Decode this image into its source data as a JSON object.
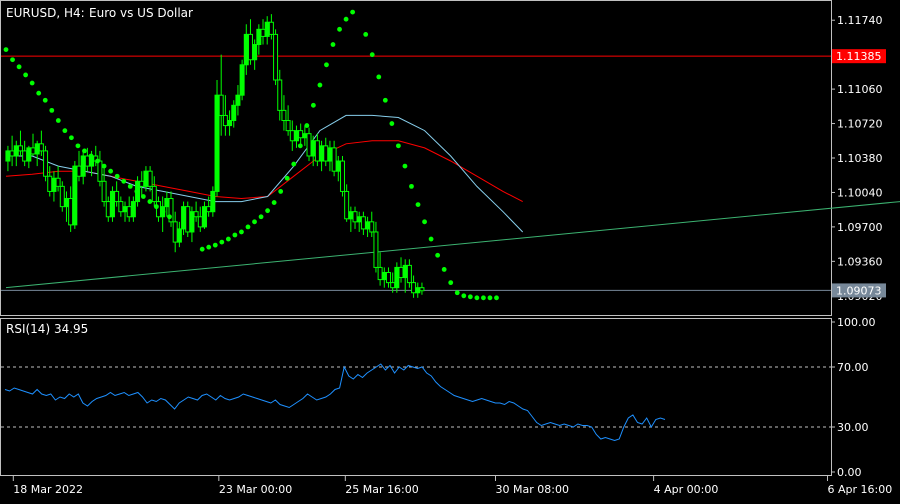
{
  "header": {
    "symbol_label": "EURUSD, H4:",
    "description": "Euro vs US Dollar"
  },
  "rsi_panel": {
    "label": "RSI(14) 34.95"
  },
  "colors": {
    "background": "#000000",
    "frame": "#c0c0c0",
    "bull_candle": "#00ff00",
    "bear_candle": "#000000",
    "sar": "#00ff00",
    "ma_fast": "#87ceeb",
    "ma_slow": "#ff0000",
    "trendline": "#3cb371",
    "resistance_line": "#ff0000",
    "bid_line": "#778899",
    "rsi_line": "#1e90ff",
    "rsi_levels": "#c0c0c0",
    "text": "#ffffff",
    "resistance_badge": "#ff0000",
    "bid_badge": "#778899"
  },
  "chart_data": [
    {
      "type": "candlestick",
      "symbol": "EURUSD",
      "timeframe": "H4",
      "y_ticks": [
        "1.11740",
        "1.11400",
        "1.11060",
        "1.10720",
        "1.10380",
        "1.10040",
        "1.09700",
        "1.09360",
        "1.09020"
      ],
      "ylim": [
        1.0886,
        1.119
      ],
      "x_tick_labels": [
        {
          "label": "18 Mar 2022",
          "bar": 0
        },
        {
          "label": "23 Mar 00:00",
          "bar": 26
        },
        {
          "label": "25 Mar 16:00",
          "bar": 42
        },
        {
          "label": "30 Mar 08:00",
          "bar": 61
        },
        {
          "label": "4 Apr 00:00",
          "bar": 81
        },
        {
          "label": "6 Apr 16:00",
          "bar": 103
        }
      ],
      "price_badges": [
        {
          "label": "1.11385",
          "price": 1.11385,
          "role": "resistance"
        },
        {
          "label": "1.09073",
          "price": 1.09073,
          "role": "bid"
        }
      ],
      "candles": [
        [
          1.1035,
          1.105,
          1.1025,
          1.1045
        ],
        [
          1.1045,
          1.106,
          1.103,
          1.104
        ],
        [
          1.104,
          1.1055,
          1.103,
          1.105
        ],
        [
          1.105,
          1.1065,
          1.104,
          1.1045
        ],
        [
          1.1045,
          1.1055,
          1.103,
          1.1035
        ],
        [
          1.1035,
          1.105,
          1.1028,
          1.1048
        ],
        [
          1.1048,
          1.1062,
          1.104,
          1.1042
        ],
        [
          1.1042,
          1.1055,
          1.103,
          1.1052
        ],
        [
          1.1052,
          1.1065,
          1.104,
          1.1045
        ],
        [
          1.1045,
          1.105,
          1.1015,
          1.102
        ],
        [
          1.102,
          1.103,
          1.1,
          1.1005
        ],
        [
          1.1005,
          1.1025,
          1.0995,
          1.1018
        ],
        [
          1.1018,
          1.103,
          1.1005,
          1.101
        ],
        [
          1.101,
          1.1015,
          1.0985,
          1.099
        ],
        [
          1.099,
          1.1005,
          1.0975,
          1.0998
        ],
        [
          1.0998,
          1.101,
          1.0965,
          1.0972
        ],
        [
          1.0972,
          1.1035,
          1.0968,
          1.103
        ],
        [
          1.103,
          1.1045,
          1.1015,
          1.102
        ],
        [
          1.102,
          1.1045,
          1.1012,
          1.104
        ],
        [
          1.104,
          1.1048,
          1.1025,
          1.103
        ],
        [
          1.103,
          1.1045,
          1.102,
          1.104
        ],
        [
          1.104,
          1.105,
          1.103,
          1.1035
        ],
        [
          1.1035,
          1.1045,
          1.101,
          1.1015
        ],
        [
          1.1015,
          1.103,
          1.099,
          1.0995
        ],
        [
          1.0995,
          1.1,
          1.0975,
          1.098
        ],
        [
          1.098,
          1.101,
          1.0975,
          1.1005
        ],
        [
          1.1005,
          1.1015,
          1.099,
          1.0995
        ],
        [
          1.0995,
          1.1,
          1.098,
          1.0985
        ],
        [
          1.0985,
          1.0995,
          1.0975,
          1.099
        ],
        [
          1.099,
          1.1,
          1.0975,
          1.098
        ],
        [
          1.098,
          1.1,
          1.0975,
          1.0995
        ],
        [
          1.0995,
          1.102,
          1.099,
          1.1015
        ],
        [
          1.1015,
          1.1025,
          1.1,
          1.101
        ],
        [
          1.101,
          1.103,
          1.1005,
          1.1025
        ],
        [
          1.1025,
          1.103,
          1.1005,
          1.101
        ],
        [
          1.101,
          1.102,
          1.099,
          1.0995
        ],
        [
          1.0995,
          1.1,
          1.0975,
          1.098
        ],
        [
          1.098,
          1.1,
          1.0965,
          1.099
        ],
        [
          1.099,
          1.1005,
          1.098,
          1.0998
        ],
        [
          1.0998,
          1.1005,
          1.097,
          1.0975
        ],
        [
          1.0975,
          1.0985,
          1.0945,
          1.0955
        ],
        [
          1.0955,
          1.0975,
          1.095,
          1.0968
        ],
        [
          1.0968,
          1.0995,
          1.0962,
          1.099
        ],
        [
          1.099,
          1.0995,
          1.096,
          1.0965
        ],
        [
          1.0965,
          1.099,
          1.0955,
          1.0985
        ],
        [
          1.0985,
          1.0995,
          1.0975,
          1.098
        ],
        [
          1.098,
          1.099,
          1.0965,
          1.097
        ],
        [
          1.097,
          1.0995,
          1.0968,
          1.099
        ],
        [
          1.099,
          1.1,
          1.098,
          1.0985
        ],
        [
          1.0985,
          1.101,
          1.098,
          1.1005
        ],
        [
          1.1005,
          1.1115,
          1.1,
          1.11
        ],
        [
          1.11,
          1.114,
          1.106,
          1.108
        ],
        [
          1.108,
          1.11,
          1.106,
          1.107
        ],
        [
          1.107,
          1.1085,
          1.106,
          1.1075
        ],
        [
          1.1075,
          1.1095,
          1.1068,
          1.109
        ],
        [
          1.109,
          1.111,
          1.108,
          1.11
        ],
        [
          1.11,
          1.1135,
          1.1095,
          1.113
        ],
        [
          1.113,
          1.117,
          1.112,
          1.116
        ],
        [
          1.116,
          1.1175,
          1.113,
          1.1135
        ],
        [
          1.1135,
          1.1155,
          1.1125,
          1.115
        ],
        [
          1.115,
          1.117,
          1.114,
          1.1165
        ],
        [
          1.1165,
          1.1175,
          1.115,
          1.1158
        ],
        [
          1.1158,
          1.1178,
          1.115,
          1.1172
        ],
        [
          1.1172,
          1.118,
          1.1155,
          1.116
        ],
        [
          1.116,
          1.1165,
          1.111,
          1.1115
        ],
        [
          1.1115,
          1.1125,
          1.1075,
          1.1085
        ],
        [
          1.1085,
          1.11,
          1.1065,
          1.1075
        ],
        [
          1.1075,
          1.109,
          1.106,
          1.1065
        ],
        [
          1.1065,
          1.1075,
          1.1045,
          1.1055
        ],
        [
          1.1055,
          1.107,
          1.1048,
          1.1065
        ],
        [
          1.1065,
          1.1072,
          1.105,
          1.1058
        ],
        [
          1.1058,
          1.107,
          1.105,
          1.1062
        ],
        [
          1.1062,
          1.1068,
          1.1035,
          1.104
        ],
        [
          1.104,
          1.106,
          1.103,
          1.1055
        ],
        [
          1.1055,
          1.1062,
          1.103,
          1.1035
        ],
        [
          1.1035,
          1.1055,
          1.1025,
          1.105
        ],
        [
          1.105,
          1.1058,
          1.103,
          1.1035
        ],
        [
          1.1035,
          1.1055,
          1.1025,
          1.1048
        ],
        [
          1.1048,
          1.1055,
          1.102,
          1.1025
        ],
        [
          1.1025,
          1.104,
          1.1015,
          1.1035
        ],
        [
          1.1035,
          1.104,
          1.1,
          1.1005
        ],
        [
          1.1005,
          1.1012,
          1.0975,
          1.0978
        ],
        [
          1.0978,
          1.099,
          1.0965,
          1.0985
        ],
        [
          1.0985,
          1.099,
          1.0968,
          1.0975
        ],
        [
          1.0975,
          1.0985,
          1.0965,
          1.098
        ],
        [
          1.098,
          1.0985,
          1.0962,
          1.0968
        ],
        [
          1.0968,
          1.098,
          1.096,
          1.0975
        ],
        [
          1.0975,
          1.0985,
          1.096,
          1.0965
        ],
        [
          1.0965,
          1.0975,
          1.0925,
          1.093
        ],
        [
          1.093,
          1.0945,
          1.0912,
          1.0918
        ],
        [
          1.0918,
          1.093,
          1.091,
          1.0925
        ],
        [
          1.0925,
          1.093,
          1.091,
          1.0915
        ],
        [
          1.0915,
          1.0925,
          1.0905,
          1.091
        ],
        [
          1.091,
          1.0935,
          1.0905,
          1.093
        ],
        [
          1.093,
          1.094,
          1.0915,
          1.092
        ],
        [
          1.092,
          1.0938,
          1.0905,
          1.0932
        ],
        [
          1.0932,
          1.0938,
          1.091,
          1.0915
        ],
        [
          1.0915,
          1.0922,
          1.09,
          1.0905
        ],
        [
          1.0905,
          1.0915,
          1.09,
          1.091
        ],
        [
          1.091,
          1.0915,
          1.0903,
          1.0907
        ]
      ],
      "parabolic_sar": [
        [
          0,
          1.1145
        ],
        [
          2,
          1.1135
        ],
        [
          4,
          1.1128
        ],
        [
          6,
          1.112
        ],
        [
          8,
          1.1112
        ],
        [
          10,
          1.1102
        ],
        [
          12,
          1.1095
        ],
        [
          14,
          1.1085
        ],
        [
          16,
          1.1075
        ],
        [
          18,
          1.1065
        ],
        [
          20,
          1.1058
        ],
        [
          22,
          1.105
        ],
        [
          24,
          1.1045
        ],
        [
          26,
          1.104
        ],
        [
          28,
          1.1035
        ],
        [
          30,
          1.103
        ],
        [
          32,
          1.1025
        ],
        [
          34,
          1.102
        ],
        [
          36,
          1.1015
        ],
        [
          38,
          1.101
        ],
        [
          40,
          1.1005
        ],
        [
          42,
          1.1
        ],
        [
          44,
          1.0995
        ],
        [
          46,
          1.099
        ],
        [
          48,
          1.0985
        ],
        [
          50,
          1.098
        ],
        [
          60,
          1.0948
        ],
        [
          62,
          1.095
        ],
        [
          64,
          1.0952
        ],
        [
          66,
          1.0955
        ],
        [
          68,
          1.0958
        ],
        [
          70,
          1.0962
        ],
        [
          72,
          1.0965
        ],
        [
          74,
          1.097
        ],
        [
          76,
          1.0975
        ],
        [
          78,
          1.098
        ],
        [
          80,
          1.0986
        ],
        [
          82,
          1.0994
        ],
        [
          84,
          1.1005
        ],
        [
          86,
          1.1018
        ],
        [
          88,
          1.1032
        ],
        [
          90,
          1.105
        ],
        [
          92,
          1.107
        ],
        [
          94,
          1.109
        ],
        [
          96,
          1.111
        ],
        [
          98,
          1.113
        ],
        [
          100,
          1.115
        ],
        [
          102,
          1.1165
        ],
        [
          104,
          1.1175
        ],
        [
          106,
          1.1182
        ],
        [
          110,
          1.116
        ],
        [
          112,
          1.114
        ],
        [
          114,
          1.1118
        ],
        [
          116,
          1.1095
        ],
        [
          118,
          1.1072
        ],
        [
          120,
          1.105
        ],
        [
          122,
          1.103
        ],
        [
          124,
          1.101
        ],
        [
          126,
          1.0992
        ],
        [
          128,
          1.0975
        ],
        [
          130,
          1.0958
        ],
        [
          132,
          1.0942
        ],
        [
          134,
          1.0928
        ],
        [
          136,
          1.0915
        ],
        [
          138,
          1.0905
        ],
        [
          140,
          1.0902
        ],
        [
          142,
          1.0901
        ],
        [
          144,
          1.09
        ],
        [
          146,
          1.09
        ],
        [
          148,
          1.09
        ],
        [
          150,
          1.09
        ]
      ],
      "ma_fast": [
        [
          0,
          1.104
        ],
        [
          8,
          1.104
        ],
        [
          16,
          1.103
        ],
        [
          24,
          1.1025
        ],
        [
          32,
          1.102
        ],
        [
          40,
          1.101
        ],
        [
          48,
          1.1005
        ],
        [
          56,
          1.1
        ],
        [
          64,
          1.0995
        ],
        [
          72,
          1.0995
        ],
        [
          80,
          1.1
        ],
        [
          88,
          1.103
        ],
        [
          96,
          1.1065
        ],
        [
          104,
          1.108
        ],
        [
          112,
          1.108
        ],
        [
          120,
          1.1078
        ],
        [
          128,
          1.1065
        ],
        [
          136,
          1.104
        ],
        [
          144,
          1.101
        ],
        [
          152,
          1.0985
        ],
        [
          158,
          1.0965
        ]
      ],
      "ma_slow": [
        [
          0,
          1.102
        ],
        [
          8,
          1.1022
        ],
        [
          16,
          1.1025
        ],
        [
          24,
          1.1025
        ],
        [
          32,
          1.102
        ],
        [
          40,
          1.1015
        ],
        [
          48,
          1.101
        ],
        [
          56,
          1.1005
        ],
        [
          64,
          1.1
        ],
        [
          72,
          1.0998
        ],
        [
          80,
          1.1
        ],
        [
          88,
          1.102
        ],
        [
          96,
          1.104
        ],
        [
          104,
          1.1052
        ],
        [
          112,
          1.1055
        ],
        [
          120,
          1.1055
        ],
        [
          128,
          1.1048
        ],
        [
          136,
          1.1035
        ],
        [
          144,
          1.102
        ],
        [
          152,
          1.1005
        ],
        [
          158,
          1.0995
        ]
      ],
      "trendline": {
        "from": [
          0,
          1.091
        ],
        "to": [
          162,
          1.0995
        ]
      },
      "resistance_line": 1.11385,
      "bid_line": 1.09073
    },
    {
      "type": "line",
      "name": "RSI(14)",
      "last_value": 34.95,
      "ylim": [
        0,
        100
      ],
      "y_ticks": [
        "100.00",
        "70.00",
        "30.00",
        "0.00"
      ],
      "levels": [
        70,
        30
      ],
      "values": [
        55,
        54,
        56,
        55,
        54,
        53,
        52,
        55,
        52,
        51,
        52,
        48,
        50,
        49,
        52,
        50,
        52,
        46,
        44,
        47,
        49,
        50,
        51,
        53,
        51,
        52,
        53,
        51,
        52,
        53,
        50,
        46,
        48,
        47,
        49,
        48,
        45,
        42,
        46,
        48,
        50,
        49,
        48,
        51,
        52,
        50,
        48,
        51,
        49,
        48,
        49,
        50,
        52,
        51,
        50,
        49,
        48,
        47,
        46,
        48,
        45,
        44,
        43,
        45,
        47,
        49,
        52,
        50,
        48,
        49,
        50,
        52,
        55,
        56,
        70,
        64,
        62,
        65,
        63,
        66,
        68,
        70,
        72,
        68,
        71,
        66,
        70,
        68,
        71,
        70,
        69,
        70,
        66,
        64,
        60,
        57,
        55,
        53,
        51,
        50,
        49,
        48,
        47,
        48,
        49,
        48,
        47,
        46,
        46,
        45,
        47,
        46,
        44,
        42,
        41,
        37,
        33,
        31,
        32,
        33,
        32,
        31,
        32,
        31,
        30,
        32,
        31,
        31,
        30,
        25,
        22,
        23,
        22,
        21,
        22,
        30,
        36,
        38,
        33,
        32,
        36,
        30,
        35,
        36,
        35
      ]
    }
  ]
}
